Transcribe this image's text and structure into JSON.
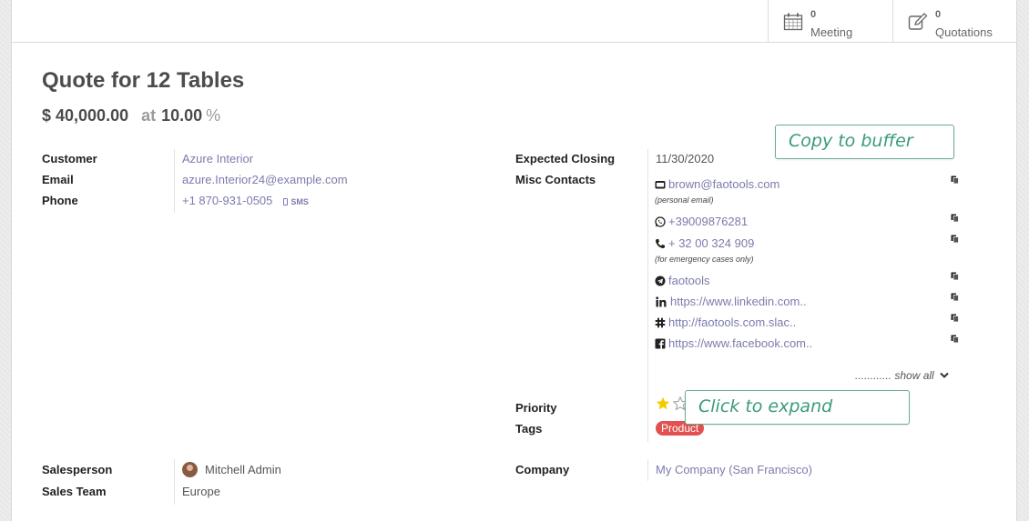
{
  "stats": [
    {
      "count": "0",
      "label": "Meeting",
      "icon": "calendar-icon"
    },
    {
      "count": "0",
      "label": "Quotations",
      "icon": "edit-icon"
    }
  ],
  "title": "Quote for 12 Tables",
  "revenue": {
    "amount": "$ 40,000.00",
    "at": "at",
    "probability": "10.00",
    "percent_sign": "%"
  },
  "left_fields": {
    "customer_label": "Customer",
    "customer": "Azure Interior",
    "email_label": "Email",
    "email": "azure.Interior24@example.com",
    "phone_label": "Phone",
    "phone": "+1 870-931-0505",
    "sms": "SMS"
  },
  "right_fields": {
    "expected_closing_label": "Expected Closing",
    "expected_closing": "11/30/2020",
    "misc_contacts_label": "Misc Contacts",
    "priority_label": "Priority",
    "tags_label": "Tags",
    "tag": "Product"
  },
  "contacts": [
    {
      "icon": "envelope-icon",
      "value": "brown@faotools.com",
      "note": "(personal email)"
    },
    {
      "icon": "whatsapp-icon",
      "value": "+39009876281",
      "note": ""
    },
    {
      "icon": "phone-icon",
      "value": "+ 32 00 324 909",
      "note": "(for emergency cases only)"
    },
    {
      "icon": "telegram-icon",
      "value": "faotools",
      "note": ""
    },
    {
      "icon": "linkedin-icon",
      "value": "https://www.linkedin.com..",
      "note": ""
    },
    {
      "icon": "slack-icon",
      "value": "http://faotools.com.slac..",
      "note": ""
    },
    {
      "icon": "facebook-icon",
      "value": "https://www.facebook.com..",
      "note": ""
    }
  ],
  "show_all": "............ show all",
  "callouts": {
    "copy": "Copy to buffer",
    "expand": "Click to expand"
  },
  "priority": {
    "filled_stars": 1,
    "total_stars": 2
  },
  "bottom_fields": {
    "salesperson_label": "Salesperson",
    "salesperson": "Mitchell Admin",
    "sales_team_label": "Sales Team",
    "sales_team": "Europe",
    "company_label": "Company",
    "company": "My Company (San Francisco)"
  },
  "colors": {
    "link": "#7c7bad",
    "tag": "#e35050",
    "callout": "#3a9b7a",
    "star": "#f3cc00"
  }
}
